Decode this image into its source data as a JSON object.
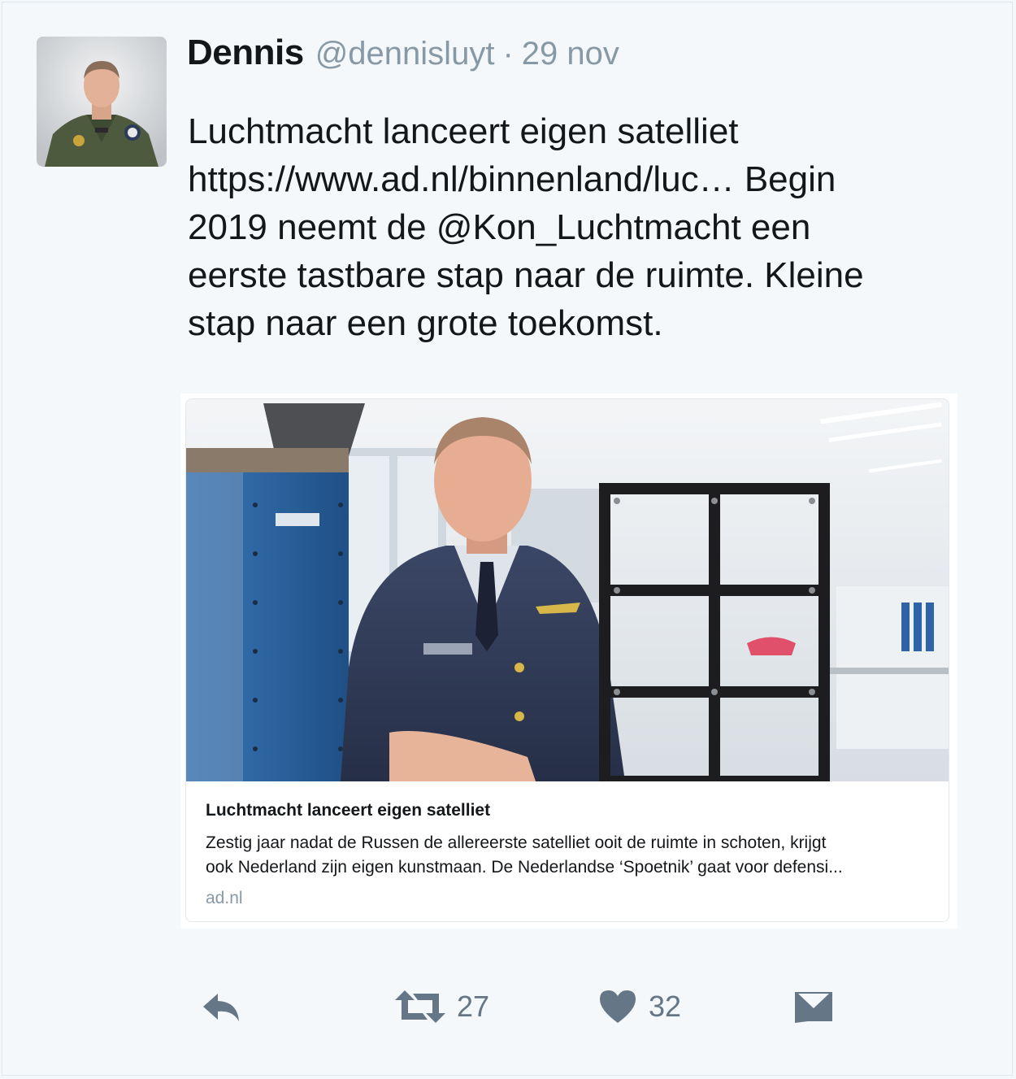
{
  "tweet": {
    "author_name": "Dennis",
    "handle": "@dennisluyt",
    "separator": "·",
    "date": "29 nov",
    "text_lines": [
      "Luchtmacht lanceert eigen satelliet",
      "https://www.ad.nl/binnenland/luc… Begin",
      "2019 neemt de @Kon_Luchtmacht een",
      "eerste tastbare stap naar de ruimte. Kleine",
      "stap naar een grote toekomst."
    ]
  },
  "card": {
    "title": "Luchtmacht lanceert eigen satelliet",
    "description_lines": [
      "Zestig jaar nadat de Russen de allereerste satelliet ooit de ruimte in schoten, krijgt",
      "ook Nederland zijn eigen kunstmaan. De Nederlandse ‘Spoetnik’ gaat voor defensi..."
    ],
    "domain": "ad.nl"
  },
  "actions": {
    "reply_icon": "reply-icon",
    "retweet_icon": "retweet-icon",
    "retweet_count": "27",
    "like_icon": "heart-icon",
    "like_count": "32",
    "dm_icon": "envelope-icon"
  },
  "colors": {
    "background": "#f5f8fa",
    "text": "#14171a",
    "muted": "#8899a6",
    "icon": "#657786"
  }
}
